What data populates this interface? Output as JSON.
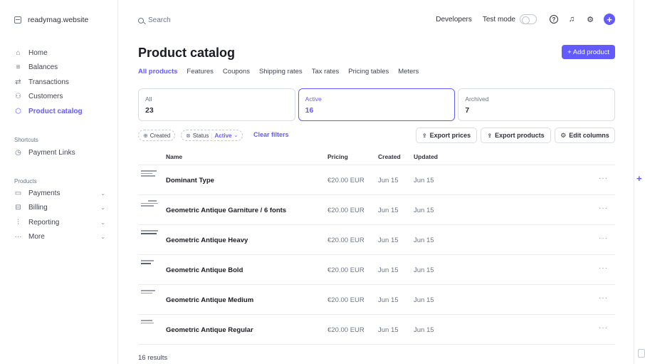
{
  "sidebar": {
    "account": "readymag.website",
    "main_items": [
      {
        "label": "Home",
        "icon": "home-icon",
        "glyph": "⌂"
      },
      {
        "label": "Balances",
        "icon": "balances-icon",
        "glyph": "≡"
      },
      {
        "label": "Transactions",
        "icon": "transactions-icon",
        "glyph": "⇄"
      },
      {
        "label": "Customers",
        "icon": "customers-icon",
        "glyph": "⚇"
      },
      {
        "label": "Product catalog",
        "icon": "product-catalog-icon",
        "glyph": "⬡"
      }
    ],
    "shortcuts_label": "Shortcuts",
    "shortcuts": [
      {
        "label": "Payment Links",
        "icon": "clock-icon",
        "glyph": "◷"
      }
    ],
    "products_label": "Products",
    "products": [
      {
        "label": "Payments",
        "icon": "payments-icon",
        "glyph": "▭"
      },
      {
        "label": "Billing",
        "icon": "billing-icon",
        "glyph": "⊟"
      },
      {
        "label": "Reporting",
        "icon": "reporting-icon",
        "glyph": "⫶"
      },
      {
        "label": "More",
        "icon": "more-dots-icon",
        "glyph": "···"
      }
    ],
    "chevron": "⌄"
  },
  "topbar": {
    "search_placeholder": "Search",
    "developers": "Developers",
    "test_mode": "Test mode",
    "help_glyph": "?",
    "bell_glyph": "♫",
    "settings_glyph": "⚙",
    "plus_glyph": "+"
  },
  "page": {
    "title": "Product catalog",
    "add_button": "+ Add product",
    "tabs": [
      "All products",
      "Features",
      "Coupons",
      "Shipping rates",
      "Tax rates",
      "Pricing tables",
      "Meters"
    ],
    "cards": [
      {
        "label": "All",
        "count": "23"
      },
      {
        "label": "Active",
        "count": "16"
      },
      {
        "label": "Archived",
        "count": "7"
      }
    ],
    "filters": {
      "created": "Created",
      "status": "Status",
      "status_value": "Active",
      "clear": "Clear filters",
      "export_prices": "Export prices",
      "export_products": "Export products",
      "edit_columns": "Edit columns"
    },
    "table": {
      "headers": {
        "name": "Name",
        "pricing": "Pricing",
        "created": "Created",
        "updated": "Updated"
      },
      "rows": [
        {
          "name": "Dominant Type",
          "pricing": "€20.00 EUR",
          "created": "Jun 15",
          "updated": "Jun 15"
        },
        {
          "name": "Geometric Antique Garniture / 6 fonts",
          "pricing": "€20.00 EUR",
          "created": "Jun 15",
          "updated": "Jun 15"
        },
        {
          "name": "Geometric Antique Heavy",
          "pricing": "€20.00 EUR",
          "created": "Jun 15",
          "updated": "Jun 15"
        },
        {
          "name": "Geometric Antique Bold",
          "pricing": "€20.00 EUR",
          "created": "Jun 15",
          "updated": "Jun 15"
        },
        {
          "name": "Geometric Antique Medium",
          "pricing": "€20.00 EUR",
          "created": "Jun 15",
          "updated": "Jun 15"
        },
        {
          "name": "Geometric Antique Regular",
          "pricing": "€20.00 EUR",
          "created": "Jun 15",
          "updated": "Jun 15"
        }
      ],
      "more_glyph": "···"
    },
    "results": "16 results"
  },
  "colors": {
    "accent": "#635bff",
    "border": "#d8dee4",
    "muted": "#6c7688"
  }
}
